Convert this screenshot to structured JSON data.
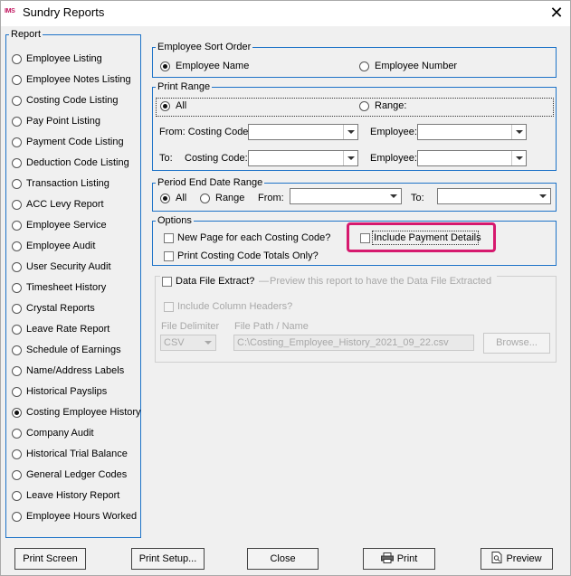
{
  "window": {
    "app_icon_text": "IMS",
    "title": "Sundry Reports",
    "close_glyph": "✕"
  },
  "report_group": {
    "legend": "Report",
    "items": [
      "Employee Listing",
      "Employee Notes Listing",
      "Costing Code Listing",
      "Pay Point Listing",
      "Payment Code Listing",
      "Deduction Code Listing",
      "Transaction Listing",
      "ACC Levy Report",
      "Employee Service",
      "Employee Audit",
      "User Security Audit",
      "Timesheet History",
      "Crystal Reports",
      "Leave Rate Report",
      "Schedule of Earnings",
      "Name/Address Labels",
      "Historical Payslips",
      "Costing Employee History",
      "Company Audit",
      "Historical Trial Balance",
      "General Ledger Codes",
      "Leave History Report",
      "Employee Hours Worked"
    ],
    "selected_item": "Costing Employee History"
  },
  "sort_order": {
    "legend": "Employee Sort Order",
    "option_name": "Employee Name",
    "option_number": "Employee Number",
    "selected": "Employee Name"
  },
  "print_range": {
    "legend": "Print Range",
    "option_all": "All",
    "option_range": "Range:",
    "selected": "All",
    "from_costing_label": "From: Costing Code:",
    "from_employee_label": "Employee:",
    "to_costing_label": "To:",
    "to_costing_label2": "Costing Code:",
    "to_employee_label": "Employee:",
    "from_costing_value": "",
    "from_employee_value": "",
    "to_costing_value": "",
    "to_employee_value": ""
  },
  "period_end": {
    "legend": "Period End Date Range",
    "option_all": "All",
    "option_range": "Range",
    "selected": "All",
    "from_label": "From:",
    "to_label": "To:",
    "from_value": "",
    "to_value": ""
  },
  "options": {
    "legend": "Options",
    "new_page": {
      "label": "New Page for each Costing Code?",
      "checked": false
    },
    "totals_only": {
      "label": "Print Costing Code Totals Only?",
      "checked": false
    },
    "include_payment": {
      "label": "Include Payment Details",
      "checked": false
    },
    "highlight_color": "#d6196e"
  },
  "data_file": {
    "legend": "Data File Extract?",
    "hint": "Preview this report to have the Data File Extracted",
    "checked": false,
    "include_headers": "Include Column Headers?",
    "delimiter_label": "File Delimiter",
    "delimiter_value": "CSV",
    "path_label": "File Path / Name",
    "path_value": "C:\\Costing_Employee_History_2021_09_22.csv",
    "browse_label": "Browse..."
  },
  "buttons": {
    "print_screen": "Print Screen",
    "print_setup": "Print Setup...",
    "close": "Close",
    "print": "Print",
    "preview": "Preview"
  },
  "colors": {
    "group_border": "#1e73c8",
    "accent_pink": "#d6196e",
    "window_bg": "#f0f0f0"
  }
}
